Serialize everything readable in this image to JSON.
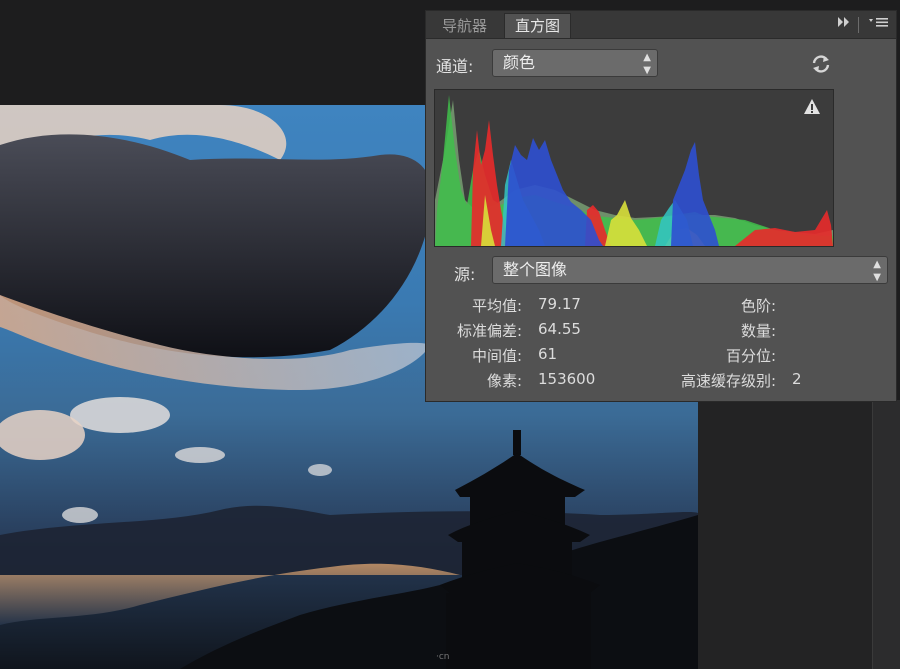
{
  "panel": {
    "tabs": [
      {
        "label": "导航器",
        "active": false
      },
      {
        "label": "直方图",
        "active": true
      }
    ],
    "channel": {
      "label": "通道:",
      "value": "颜色"
    },
    "source": {
      "label": "源:",
      "value": "整个图像"
    },
    "stats_left": [
      {
        "key": "平均值:",
        "value": "79.17"
      },
      {
        "key": "标准偏差:",
        "value": "64.55"
      },
      {
        "key": "中间值:",
        "value": "61"
      },
      {
        "key": "像素:",
        "value": "153600"
      }
    ],
    "stats_right": [
      {
        "key": "色阶:",
        "value": ""
      },
      {
        "key": "数量:",
        "value": ""
      },
      {
        "key": "百分位:",
        "value": ""
      },
      {
        "key": "高速缓存级别:",
        "value": "2"
      }
    ],
    "icons": {
      "collapse": "double-chevron-right-icon",
      "menu": "panel-menu-icon",
      "refresh": "refresh-icon",
      "warning": "cache-warning-icon"
    }
  },
  "watermark": "·cn",
  "colors": {
    "panel_bg": "#525252",
    "histogram_bg": "#3c3c3c",
    "red": "#e52b2b",
    "green": "#3fbf4a",
    "blue": "#2d4fd0",
    "cyan": "#33c4c4",
    "yellow": "#d8e03a",
    "overlap_gray": "#6f8f6a"
  }
}
